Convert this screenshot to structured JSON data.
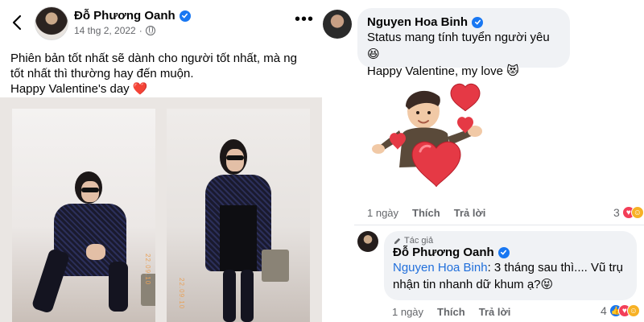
{
  "post": {
    "author_name": "Đỗ Phương Oanh",
    "date": "14 thg 2, 2022",
    "date_separator": "·",
    "text_line1": "Phiên bản tốt nhất sẽ dành cho người tốt nhất, mà ng tốt nhất thì thường hay đến muộn.",
    "text_line2": "Happy Valentine's day",
    "heart_emoji": "❤️",
    "photo1_stamp": "22.09.10",
    "photo2_stamp": "22.09.10"
  },
  "comment1": {
    "author_name": "Nguyen Hoa Binh",
    "line1": "Status mang tính tuyển người yêu",
    "line1_emoji": "😆",
    "line2": "Happy Valentine, my love",
    "line2_emoji": "😻",
    "time": "1 ngày",
    "like_label": "Thích",
    "reply_label": "Trả lời",
    "reaction_count": "3"
  },
  "comment2": {
    "author_tag": "Tác giả",
    "author_name": "Đỗ Phương Oanh",
    "mention": "Nguyen Hoa Binh",
    "text": ": 3 tháng sau thì.... Vũ trụ nhận tin nhanh dữ khum ạ?",
    "emoji": "😝",
    "time": "1 ngày",
    "like_label": "Thích",
    "reply_label": "Trả lời",
    "reaction_count": "4"
  },
  "colors": {
    "accent_blue": "#1877f2",
    "mention_blue": "#216fdb",
    "heart_red": "#e0245e",
    "bubble_gray": "#f0f2f5",
    "meta_gray": "#65676b"
  },
  "icons": [
    "back-arrow-icon",
    "verified-badge-icon",
    "globe-icon",
    "more-options-icon",
    "pencil-icon",
    "like-reaction-icon",
    "love-reaction-icon",
    "haha-reaction-icon"
  ]
}
